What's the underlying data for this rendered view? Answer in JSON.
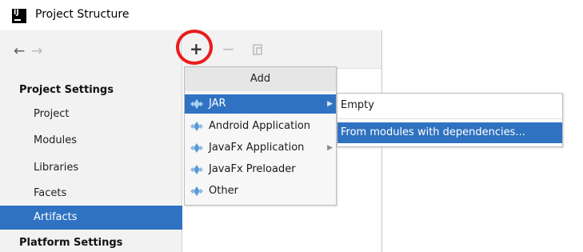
{
  "window": {
    "title": "Project Structure",
    "icon": "intellij-icon"
  },
  "nav": {
    "back_glyph": "←",
    "forward_glyph": "→"
  },
  "sidebar": {
    "project_settings_heading": "Project Settings",
    "items": [
      {
        "label": "Project"
      },
      {
        "label": "Modules"
      },
      {
        "label": "Libraries"
      },
      {
        "label": "Facets"
      },
      {
        "label": "Artifacts",
        "selected": true
      }
    ],
    "platform_settings_heading": "Platform Settings"
  },
  "toolbar": {
    "add_glyph": "+",
    "remove_glyph": "−"
  },
  "add_menu": {
    "header": "Add",
    "items": [
      {
        "label": "JAR",
        "selected": true,
        "has_submenu": true
      },
      {
        "label": "Android Application"
      },
      {
        "label": "JavaFx Application",
        "has_submenu": true
      },
      {
        "label": "JavaFx Preloader"
      },
      {
        "label": "Other"
      }
    ],
    "submenu_arrow": "▶"
  },
  "jar_submenu": {
    "items": [
      {
        "label": "Empty"
      },
      {
        "label": "From modules with dependencies...",
        "selected": true
      }
    ]
  },
  "colors": {
    "selection": "#2f72c1",
    "highlight_circle": "#ea1c1c",
    "artifact_icon": "#5b9bd5"
  }
}
